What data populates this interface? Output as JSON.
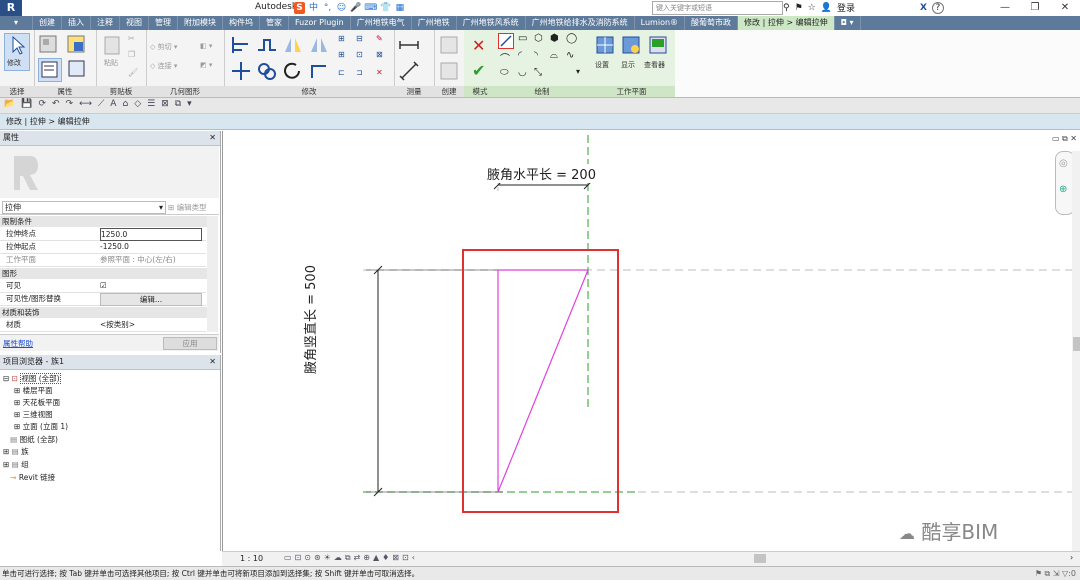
{
  "window": {
    "title": "Autodesk",
    "logo": "R",
    "search_placeholder": "键入关键字或短语",
    "login_label": "登录",
    "help_label": "?"
  },
  "ime": {
    "s_logo": "S",
    "items": [
      "中",
      "°,",
      "☺",
      "🎤",
      "⌨",
      "👕",
      "▦"
    ]
  },
  "tabs": [
    "创建",
    "插入",
    "注释",
    "视图",
    "管理",
    "附加模块",
    "构件坞",
    "管家",
    "Fuzor Plugin",
    "广州地铁电气",
    "广州地铁",
    "广州地铁风系统",
    "广州地铁给排水及消防系统",
    "Lumion®",
    "酸葡萄市政",
    "修改 | 拉伸 > 编辑拉伸"
  ],
  "ribbon": {
    "select_label": "选择",
    "modify_label": "修改",
    "panels": {
      "select": "选择",
      "properties": "属性",
      "clipboard": "剪贴板",
      "geometry": "几何图形",
      "modify": "修改",
      "measure": "测量",
      "create": "创建",
      "mode": "模式",
      "draw": "绘制",
      "workplane": "工作平面"
    },
    "clipboard_paste": "粘贴",
    "geom_cut": "剪切",
    "geom_join": "连接",
    "wp_set": "设置",
    "wp_show": "显示",
    "wp_viewer": "查看器"
  },
  "breadcrumb": "修改 | 拉伸 > 编辑拉伸",
  "properties": {
    "title": "属性",
    "type_name": "拉伸",
    "edit_type": "编辑类型",
    "categories": {
      "constraints": "限制条件",
      "graphics": "图形",
      "materials": "材质和装饰"
    },
    "rows": [
      {
        "key": "拉伸终点",
        "value": "1250.0"
      },
      {
        "key": "拉伸起点",
        "value": "-1250.0"
      },
      {
        "key": "工作平面",
        "value": "参照平面 : 中心(左/右)"
      },
      {
        "key": "可见",
        "value": "☑"
      },
      {
        "key": "可见性/图形替换",
        "value": "编辑..."
      },
      {
        "key": "材质",
        "value": "<按类别>"
      }
    ],
    "help_link": "属性帮助",
    "apply_button": "应用"
  },
  "browser": {
    "title": "项目浏览器 - 族1",
    "items": [
      {
        "label": "视图 (全部)",
        "level": 0
      },
      {
        "label": "楼层平面",
        "level": 1
      },
      {
        "label": "天花板平面",
        "level": 1
      },
      {
        "label": "三维视图",
        "level": 1
      },
      {
        "label": "立面 (立面 1)",
        "level": 1
      },
      {
        "label": "图纸 (全部)",
        "level": 0
      },
      {
        "label": "族",
        "level": 0
      },
      {
        "label": "组",
        "level": 0
      },
      {
        "label": "Revit 链接",
        "level": 0
      }
    ]
  },
  "canvas": {
    "dim_horizontal": "腋角水平长 = 200",
    "dim_vertical": "腋角竖直长 = 500"
  },
  "viewbar": {
    "scale": "1 : 10"
  },
  "status": "单击可进行选择; 按 Tab 键并单击可选择其他项目; 按 Ctrl 键并单击可将新项目添加到选择集; 按 Shift 键并单击可取消选择。",
  "status_right": ":0",
  "watermark": "酷享BIM",
  "colors": {
    "tab_bg": "#5d7a9a",
    "active_tab": "#cbe7c4",
    "sketch": "#e040e0",
    "highlight": "#e03030",
    "ref_green": "#2aa02a"
  }
}
